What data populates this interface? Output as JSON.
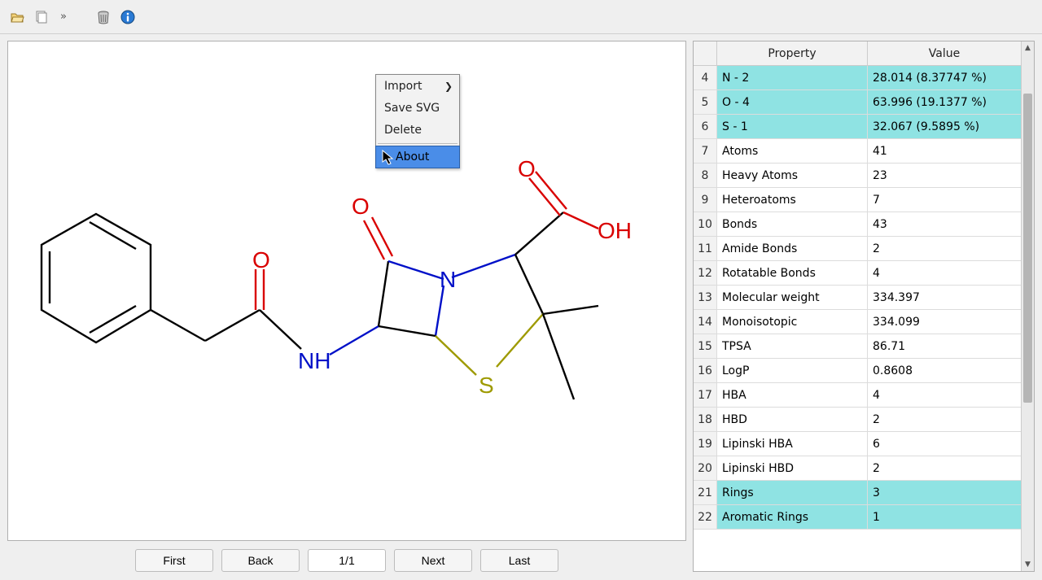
{
  "toolbar": {
    "icons": [
      "open",
      "copy",
      "trash",
      "info"
    ]
  },
  "context_menu": {
    "items": [
      {
        "label": "Import",
        "submenu": true,
        "selected": false
      },
      {
        "label": "Save SVG",
        "submenu": false,
        "selected": false
      },
      {
        "label": "Delete",
        "submenu": false,
        "selected": false
      },
      {
        "label": "About",
        "submenu": false,
        "selected": true
      }
    ]
  },
  "nav": {
    "first": "First",
    "back": "Back",
    "page": "1/1",
    "next": "Next",
    "last": "Last"
  },
  "table": {
    "headers": {
      "property": "Property",
      "value": "Value"
    },
    "rows": [
      {
        "n": "4",
        "prop": "N - 2",
        "val": "28.014 (8.37747 %)",
        "hl": true
      },
      {
        "n": "5",
        "prop": "O - 4",
        "val": "63.996 (19.1377 %)",
        "hl": true
      },
      {
        "n": "6",
        "prop": "S - 1",
        "val": "32.067 (9.5895 %)",
        "hl": true
      },
      {
        "n": "7",
        "prop": "Atoms",
        "val": "41",
        "hl": false
      },
      {
        "n": "8",
        "prop": "Heavy Atoms",
        "val": "23",
        "hl": false
      },
      {
        "n": "9",
        "prop": "Heteroatoms",
        "val": "7",
        "hl": false
      },
      {
        "n": "10",
        "prop": "Bonds",
        "val": "43",
        "hl": false
      },
      {
        "n": "11",
        "prop": "Amide Bonds",
        "val": "2",
        "hl": false
      },
      {
        "n": "12",
        "prop": "Rotatable Bonds",
        "val": "4",
        "hl": false
      },
      {
        "n": "13",
        "prop": "Molecular weight",
        "val": "334.397",
        "hl": false
      },
      {
        "n": "14",
        "prop": "Monoisotopic",
        "val": "334.099",
        "hl": false
      },
      {
        "n": "15",
        "prop": "TPSA",
        "val": "86.71",
        "hl": false
      },
      {
        "n": "16",
        "prop": "LogP",
        "val": "0.8608",
        "hl": false
      },
      {
        "n": "17",
        "prop": "HBA",
        "val": "4",
        "hl": false
      },
      {
        "n": "18",
        "prop": "HBD",
        "val": "2",
        "hl": false
      },
      {
        "n": "19",
        "prop": "Lipinski HBA",
        "val": "6",
        "hl": false
      },
      {
        "n": "20",
        "prop": "Lipinski HBD",
        "val": "2",
        "hl": false
      },
      {
        "n": "21",
        "prop": "Rings",
        "val": "3",
        "hl": true
      },
      {
        "n": "22",
        "prop": "Aromatic Rings",
        "val": "1",
        "hl": true
      }
    ]
  },
  "molecule": {
    "labels": {
      "O1": "O",
      "O2": "O",
      "O3": "O",
      "OH": "OH",
      "N": "N",
      "NH": "NH",
      "S": "S"
    },
    "colors": {
      "O": "#d90000",
      "N": "#0010c8",
      "S": "#9e9a00",
      "C": "#000"
    }
  }
}
